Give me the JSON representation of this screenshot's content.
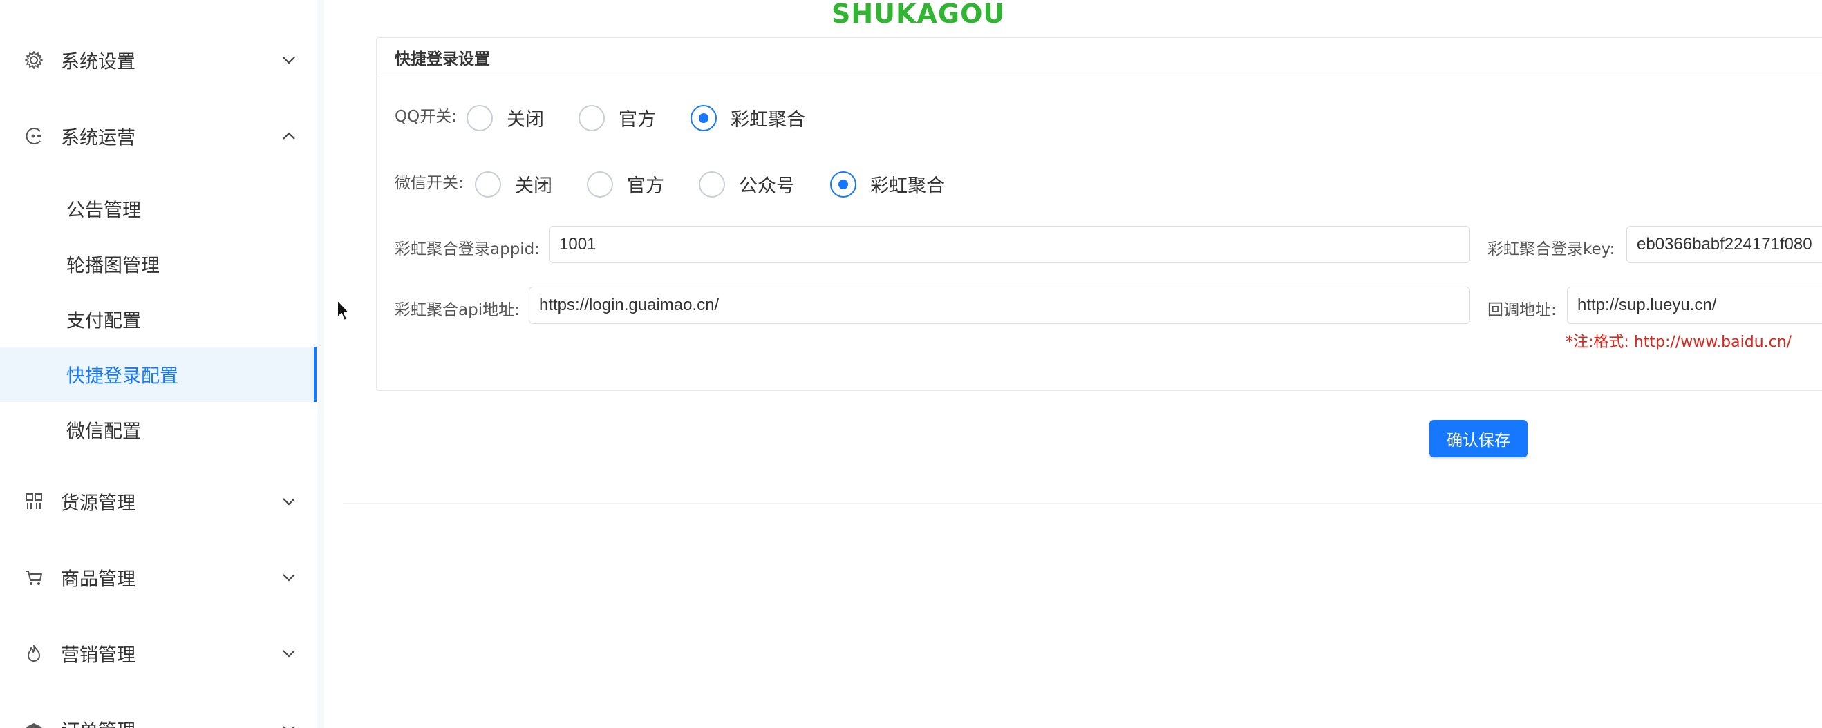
{
  "brand": {
    "text": "SHUKAGOU"
  },
  "sidebar": {
    "groups": [
      {
        "label": "系统设置",
        "icon": "gear-icon",
        "expanded": false
      },
      {
        "label": "系统运营",
        "icon": "operations-icon",
        "expanded": true
      },
      {
        "label": "货源管理",
        "icon": "grid-icon",
        "expanded": false
      },
      {
        "label": "商品管理",
        "icon": "cart-icon",
        "expanded": false
      },
      {
        "label": "营销管理",
        "icon": "flame-icon",
        "expanded": false
      },
      {
        "label": "订单管理",
        "icon": "order-icon",
        "expanded": false
      }
    ],
    "submenu": [
      {
        "label": "公告管理"
      },
      {
        "label": "轮播图管理"
      },
      {
        "label": "支付配置"
      },
      {
        "label": "快捷登录配置",
        "active": true
      },
      {
        "label": "微信配置"
      }
    ]
  },
  "card": {
    "title": "快捷登录设置",
    "qq": {
      "label": "QQ开关:",
      "options": [
        "关闭",
        "官方",
        "彩虹聚合"
      ],
      "selected": "彩虹聚合"
    },
    "wechat": {
      "label": "微信开关:",
      "options": [
        "关闭",
        "官方",
        "公众号",
        "彩虹聚合"
      ],
      "selected": "彩虹聚合"
    },
    "appid": {
      "label": "彩虹聚合登录appid:",
      "value": "1001"
    },
    "key": {
      "label": "彩虹聚合登录key:",
      "value": "eb0366babf224171f080"
    },
    "api": {
      "label": "彩虹聚合api地址:",
      "value": "https://login.guaimao.cn/"
    },
    "callback": {
      "label": "回调地址:",
      "value": "http://sup.lueyu.cn/"
    },
    "note": {
      "prefix": "*注:格式:",
      "example": "http://www.baidu.cn/"
    }
  },
  "actions": {
    "save_label": "确认保存"
  },
  "colors": {
    "accent": "#1677ff",
    "brand": "#2fb52f",
    "note": "#e0251b"
  }
}
